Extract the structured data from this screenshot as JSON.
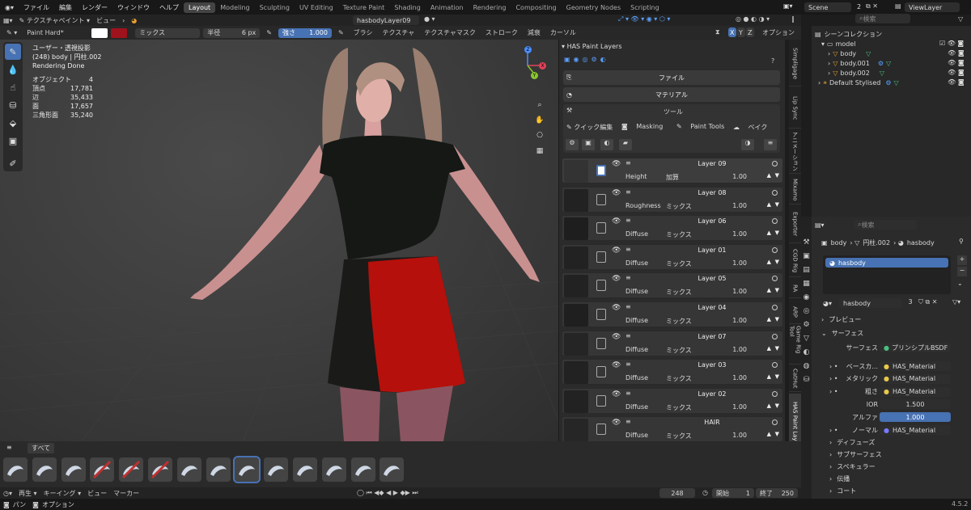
{
  "topbar": {
    "menus": [
      "ファイル",
      "編集",
      "レンダー",
      "ウィンドウ",
      "ヘルプ"
    ],
    "workspaces": [
      "Layout",
      "Modeling",
      "Sculpting",
      "UV Editing",
      "Texture Paint",
      "Shading",
      "Animation",
      "Rendering",
      "Compositing",
      "Geometry Nodes",
      "Scripting"
    ],
    "active_workspace": "Layout",
    "scene": "Scene",
    "scene_users": "2",
    "view_layer": "ViewLayer"
  },
  "header2": {
    "mode": "テクスチャペイント",
    "view": "ビュー",
    "image_name": "hasbodyLayer09",
    "search_placeholder": "検索"
  },
  "toolhdr": {
    "brush": "Paint Hard*",
    "blend": "ミックス",
    "radius_label": "半径",
    "radius_value": "6 px",
    "strength_label": "強さ",
    "strength_value": "1.000",
    "menus": [
      "ブラシ",
      "テクスチャ",
      "テクスチャマスク",
      "ストローク",
      "減衰",
      "カーソル"
    ],
    "x": "X",
    "y": "Y",
    "z": "Z",
    "options": "オプション",
    "color_primary": "#ffffff",
    "color_secondary": "#a0121c"
  },
  "stats": {
    "title": "ユーザー・透視投影",
    "subtitle": "(248) body | 円柱.002",
    "status": "Rendering Done",
    "rows": [
      {
        "label": "オブジェクト",
        "value": "4"
      },
      {
        "label": "頂点",
        "value": "17,781"
      },
      {
        "label": "辺",
        "value": "35,433"
      },
      {
        "label": "面",
        "value": "17,657"
      },
      {
        "label": "三角形面",
        "value": "35,240"
      }
    ]
  },
  "gizmo": {
    "x": "X",
    "y": "Y",
    "z": "Z"
  },
  "panel": {
    "title": "HAS Paint Layers",
    "file": "ファイル",
    "material": "マテリアル",
    "tools": "ツール",
    "quick_edit": "クイック編集",
    "masking": "Masking",
    "paint_tools": "Paint Tools",
    "bake": "ベイク",
    "layers": [
      {
        "name": "Layer 09",
        "channel": "Height",
        "blend": "加算",
        "opacity": "1.00"
      },
      {
        "name": "Layer 08",
        "channel": "Roughness",
        "blend": "ミックス",
        "opacity": "1.00"
      },
      {
        "name": "Layer 06",
        "channel": "Diffuse",
        "blend": "ミックス",
        "opacity": "1.00"
      },
      {
        "name": "Layer 01",
        "channel": "Diffuse",
        "blend": "ミックス",
        "opacity": "1.00"
      },
      {
        "name": "Layer 05",
        "channel": "Diffuse",
        "blend": "ミックス",
        "opacity": "1.00"
      },
      {
        "name": "Layer 04",
        "channel": "Diffuse",
        "blend": "ミックス",
        "opacity": "1.00"
      },
      {
        "name": "Layer 07",
        "channel": "Diffuse",
        "blend": "ミックス",
        "opacity": "1.00"
      },
      {
        "name": "Layer 03",
        "channel": "Diffuse",
        "blend": "ミックス",
        "opacity": "1.00"
      },
      {
        "name": "Layer 02",
        "channel": "Diffuse",
        "blend": "ミックス",
        "opacity": "1.00"
      },
      {
        "name": "HAIR",
        "channel": "Diffuse",
        "blend": "ミックス",
        "opacity": "1.00"
      }
    ]
  },
  "vtabs": [
    "Simpligage",
    "Lip Sync",
    "アニメーション",
    "Mixamo",
    "Exporter",
    "CGD Rig",
    "RA",
    "ARP",
    "Game Rig Tool",
    "CatHut",
    "HAS Paint Layers"
  ],
  "outliner": {
    "title": "シーンコレクション",
    "items": [
      "model",
      "body",
      "body.001",
      "body.002",
      "Default Stylised"
    ]
  },
  "props": {
    "search_placeholder": "検索",
    "breadcrumb": [
      "body",
      "円柱.002",
      "hasbody"
    ],
    "slot": "hasbody",
    "material": "hasbody",
    "users": "3",
    "preview": "プレビュー",
    "surface_header": "サーフェス",
    "surface_label": "サーフェス",
    "surface_value": "プリンシプルBSDF",
    "rows": [
      {
        "label": "ベースカ...",
        "value": "HAS_Material"
      },
      {
        "label": "メタリック",
        "value": "HAS_Material"
      },
      {
        "label": "粗さ",
        "value": "HAS_Material"
      },
      {
        "label": "IOR",
        "value": "1.500"
      },
      {
        "label": "アルファ",
        "value": "1.000"
      },
      {
        "label": "ノーマル",
        "value": "HAS_Material"
      }
    ],
    "sections": [
      "ディフューズ",
      "サブサーフェス",
      "スペキュラー",
      "伝播",
      "コート"
    ]
  },
  "shelf": {
    "tab": "すべて"
  },
  "timeline": {
    "playback": "再生",
    "keying": "キーイング",
    "view": "ビュー",
    "marker": "マーカー",
    "current": "248",
    "start_label": "開始",
    "start": "1",
    "end_label": "終了",
    "end": "250"
  },
  "status": {
    "pan": "パン",
    "options": "オプション",
    "version": "4.5.2"
  }
}
